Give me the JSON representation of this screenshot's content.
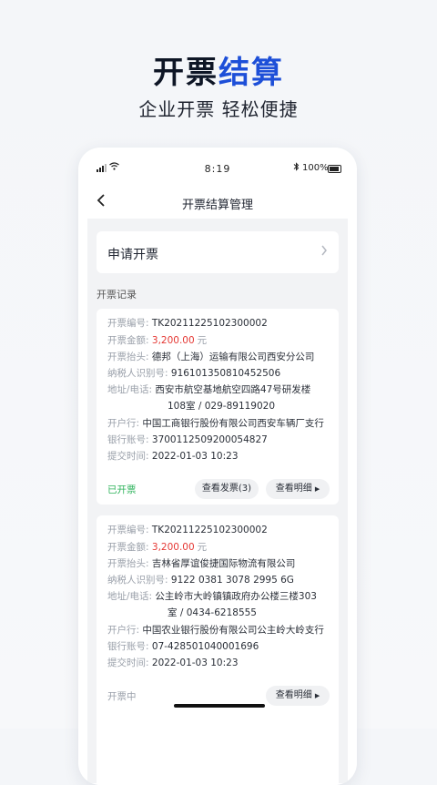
{
  "hero": {
    "title_part1": "开票",
    "title_part2": "结算",
    "subtitle": "企业开票  轻松便捷"
  },
  "status_bar": {
    "time": "8:19",
    "battery": "100%"
  },
  "nav": {
    "title": "开票结算管理",
    "back_icon": "back-chevron-icon"
  },
  "apply": {
    "label": "申请开票"
  },
  "records_section": {
    "title": "开票记录"
  },
  "records": [
    {
      "no_label": "开票编号:",
      "no": "TK20211225102300002",
      "amount_label": "开票金额:",
      "amount": "3,200.00",
      "unit": "元",
      "header_label": "开票抬头:",
      "header": "德邦（上海）运输有限公司西安分公司",
      "tax_label": "纳税人识别号:",
      "tax": "916101350810452506",
      "addr_label": "地址/电话:",
      "addr_line1": "西安市航空基地航空四路47号研发楼",
      "addr_line2": "108室 / 029-89119020",
      "bank_label": "开户行:",
      "bank": "中国工商银行股份有限公司西安车辆厂支行",
      "account_label": "银行账号:",
      "account": "3700112509200054827",
      "time_label": "提交时间:",
      "time": "2022-01-03 10:23",
      "status": "已开票",
      "view_invoice": "查看发票(3)",
      "view_detail": "查看明细"
    },
    {
      "no_label": "开票编号:",
      "no": "TK20211225102300002",
      "amount_label": "开票金额:",
      "amount": "3,200.00",
      "unit": "元",
      "header_label": "开票抬头:",
      "header": "吉林省厚谊俊捷国际物流有限公司",
      "tax_label": "纳税人识别号:",
      "tax": "9122 0381 3078 2995 6G",
      "addr_label": "地址/电话:",
      "addr_line1": "公主岭市大岭镇镇政府办公楼三楼303",
      "addr_line2": "室 / 0434-6218555",
      "bank_label": "开户行:",
      "bank": "中国农业银行股份有限公司公主岭大岭支行",
      "account_label": "银行账号:",
      "account": "07-428501040001696",
      "time_label": "提交时间:",
      "time": "2022-01-03 10:23",
      "status": "开票中",
      "view_detail": "查看明细"
    }
  ],
  "colors": {
    "accent": "#1d4fd8",
    "amount_red": "#e53935",
    "status_green": "#2fb35c"
  }
}
